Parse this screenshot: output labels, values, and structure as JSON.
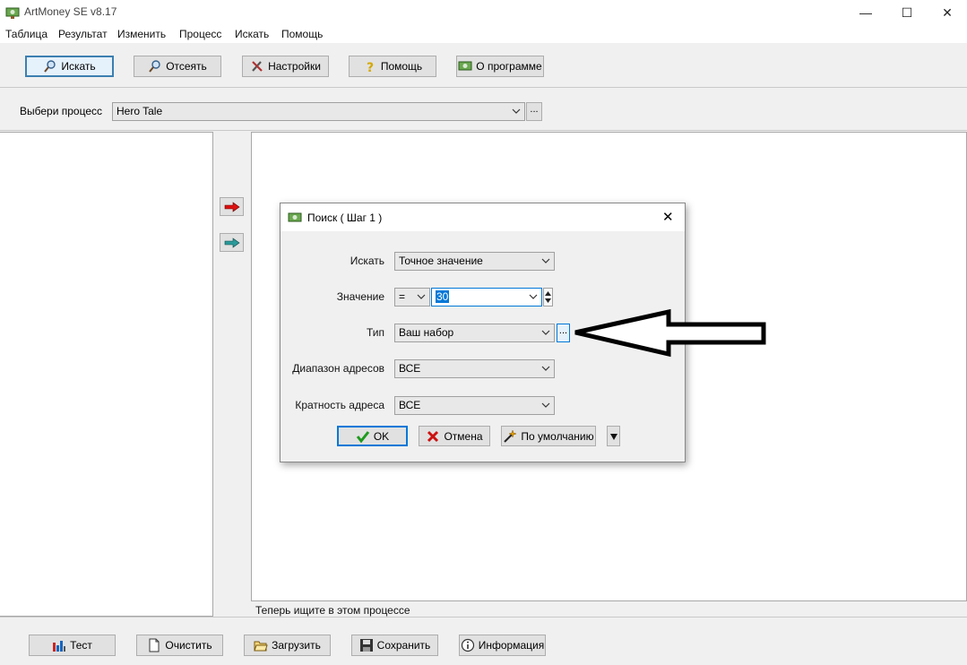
{
  "window": {
    "title": "ArtMoney SE v8.17",
    "controls": {
      "minimize": "—",
      "maximize": "☐",
      "close": "✕"
    }
  },
  "menu": [
    "Таблица",
    "Результат",
    "Изменить",
    "Процесс",
    "Искать",
    "Помощь"
  ],
  "toolbar": {
    "search": "Искать",
    "filter": "Отсеять",
    "settings": "Настройки",
    "help": "Помощь",
    "about": "О программе"
  },
  "process": {
    "label": "Выбери процесс",
    "value": "Hero Tale",
    "browse": "..."
  },
  "status": "Теперь ищите в этом процессе",
  "bottom": {
    "test": "Тест",
    "clear": "Очистить",
    "load": "Загрузить",
    "save": "Сохранить",
    "info": "Информация"
  },
  "dialog": {
    "title": "Поиск ( Шаг 1 )",
    "close": "✕",
    "search_label": "Искать",
    "search_value": "Точное значение",
    "value_label": "Значение",
    "operator": "=",
    "value": "30",
    "type_label": "Тип",
    "type_value": "Ваш набор",
    "type_browse": "...",
    "range_label": "Диапазон адресов",
    "range_value": "ВСЕ",
    "align_label": "Кратность адреса",
    "align_value": "ВСЕ",
    "ok": "OK",
    "cancel": "Отмена",
    "default": "По умолчанию"
  },
  "colors": {
    "accent": "#0078d7",
    "ok_check": "#1e9a1e",
    "cancel_x": "#cc1111"
  }
}
